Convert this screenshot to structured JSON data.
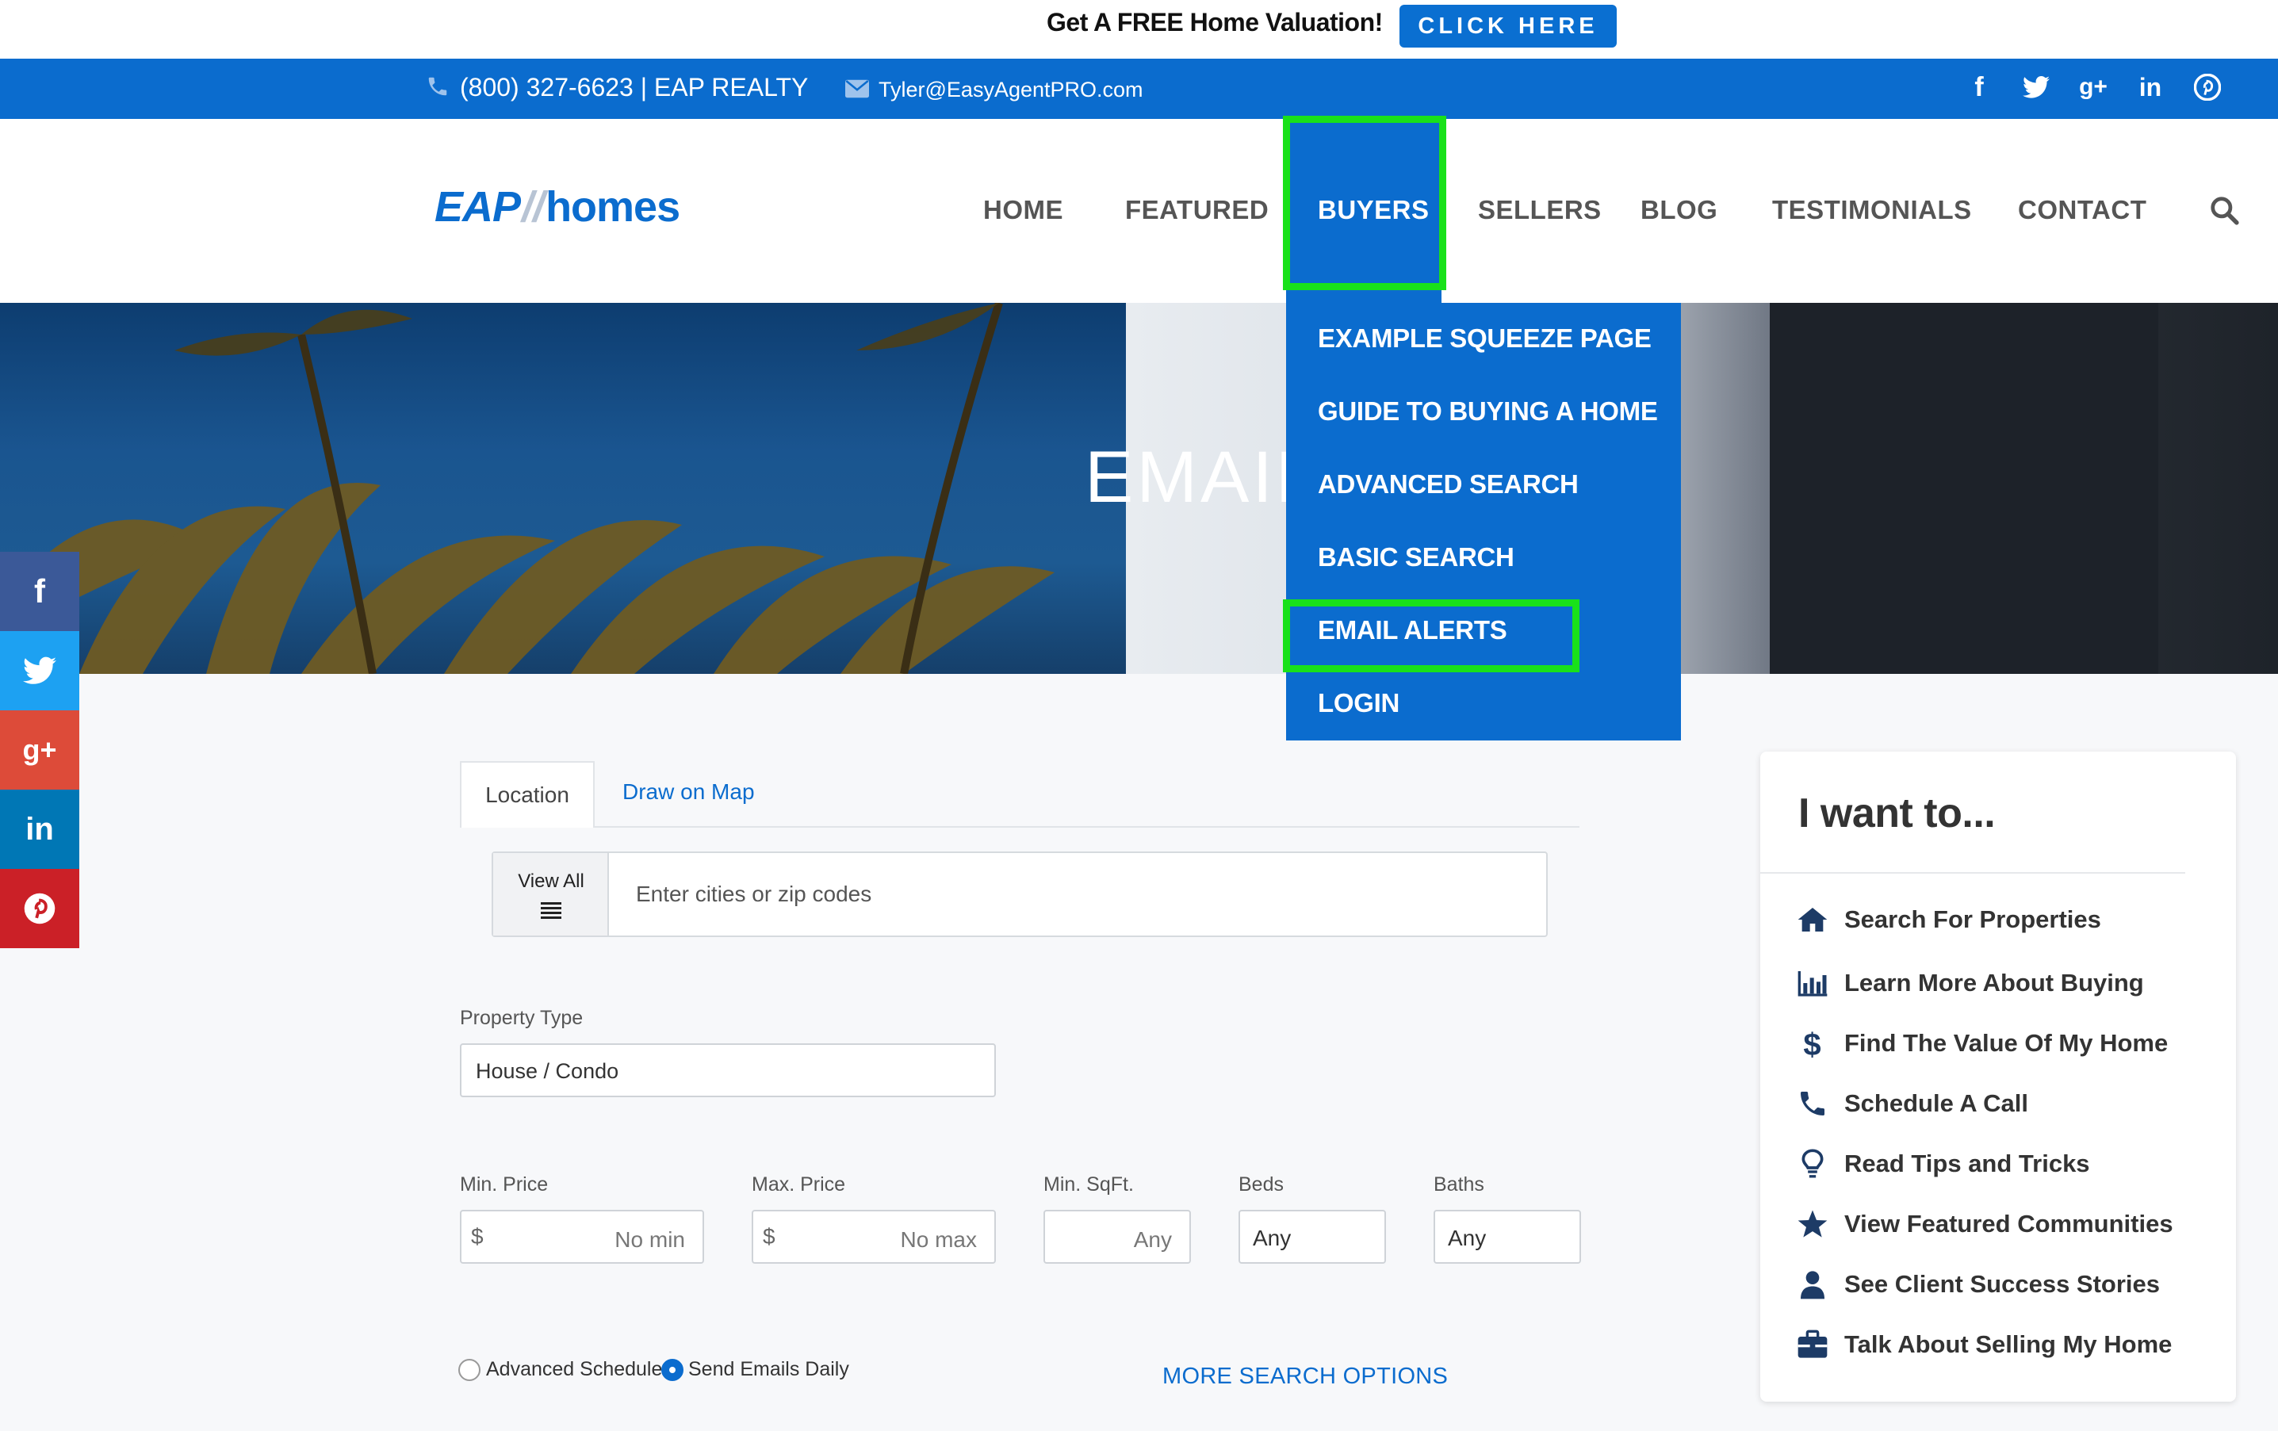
{
  "promo": {
    "text": "Get A FREE Home Valuation!",
    "button": "CLICK HERE"
  },
  "topbar": {
    "phone": "(800) 327-6623 | EAP REALTY",
    "email": "Tyler@EasyAgentPRO.com",
    "social": [
      {
        "name": "facebook",
        "glyph": "f"
      },
      {
        "name": "twitter",
        "glyph": "t"
      },
      {
        "name": "google-plus",
        "glyph": "g+"
      },
      {
        "name": "linkedin",
        "glyph": "in"
      },
      {
        "name": "pinterest",
        "glyph": "p"
      }
    ]
  },
  "logo": {
    "eap": "EAP",
    "slash": "//",
    "homes": "homes"
  },
  "nav": {
    "home": "HOME",
    "featured": "FEATURED",
    "buyers": "BUYERS",
    "sellers": "SELLERS",
    "blog": "BLOG",
    "testimonials": "TESTIMONIALS",
    "contact": "CONTACT"
  },
  "hero": {
    "title": "EMAIL"
  },
  "dropdown": {
    "items": [
      "EXAMPLE SQUEEZE PAGE",
      "GUIDE TO BUYING A HOME",
      "ADVANCED SEARCH",
      "BASIC SEARCH",
      "EMAIL ALERTS",
      "LOGIN"
    ]
  },
  "side_social": [
    {
      "name": "facebook",
      "glyph": "f",
      "color": "#3b5998"
    },
    {
      "name": "twitter",
      "glyph": "t",
      "color": "#1da1f2"
    },
    {
      "name": "google-plus",
      "glyph": "g+",
      "color": "#dd4b39"
    },
    {
      "name": "linkedin",
      "glyph": "in",
      "color": "#0077b5"
    },
    {
      "name": "pinterest",
      "glyph": "p",
      "color": "#cb2027"
    }
  ],
  "search": {
    "tabs": {
      "location": "Location",
      "draw_map": "Draw on Map"
    },
    "view_all": "View All",
    "location_placeholder": "Enter cities or zip codes",
    "property_type_label": "Property Type",
    "property_type_value": "House / Condo",
    "min_price_label": "Min. Price",
    "min_price_placeholder": "No min",
    "max_price_label": "Max. Price",
    "max_price_placeholder": "No max",
    "min_sqft_label": "Min. SqFt.",
    "min_sqft_placeholder": "Any",
    "beds_label": "Beds",
    "beds_value": "Any",
    "baths_label": "Baths",
    "baths_value": "Any",
    "currency": "$",
    "schedule_advanced": "Advanced Schedule",
    "schedule_daily": "Send Emails Daily",
    "more_options": "MORE SEARCH OPTIONS"
  },
  "sidebar": {
    "title": "I want to...",
    "links": [
      "Search For Properties",
      "Learn More About Buying",
      "Find The Value Of My Home",
      "Schedule A Call",
      "Read Tips and Tricks",
      "View Featured Communities",
      "See Client Success Stories",
      "Talk About Selling My Home"
    ]
  },
  "colors": {
    "brand": "#0b6cce",
    "highlight": "#19e11a"
  }
}
